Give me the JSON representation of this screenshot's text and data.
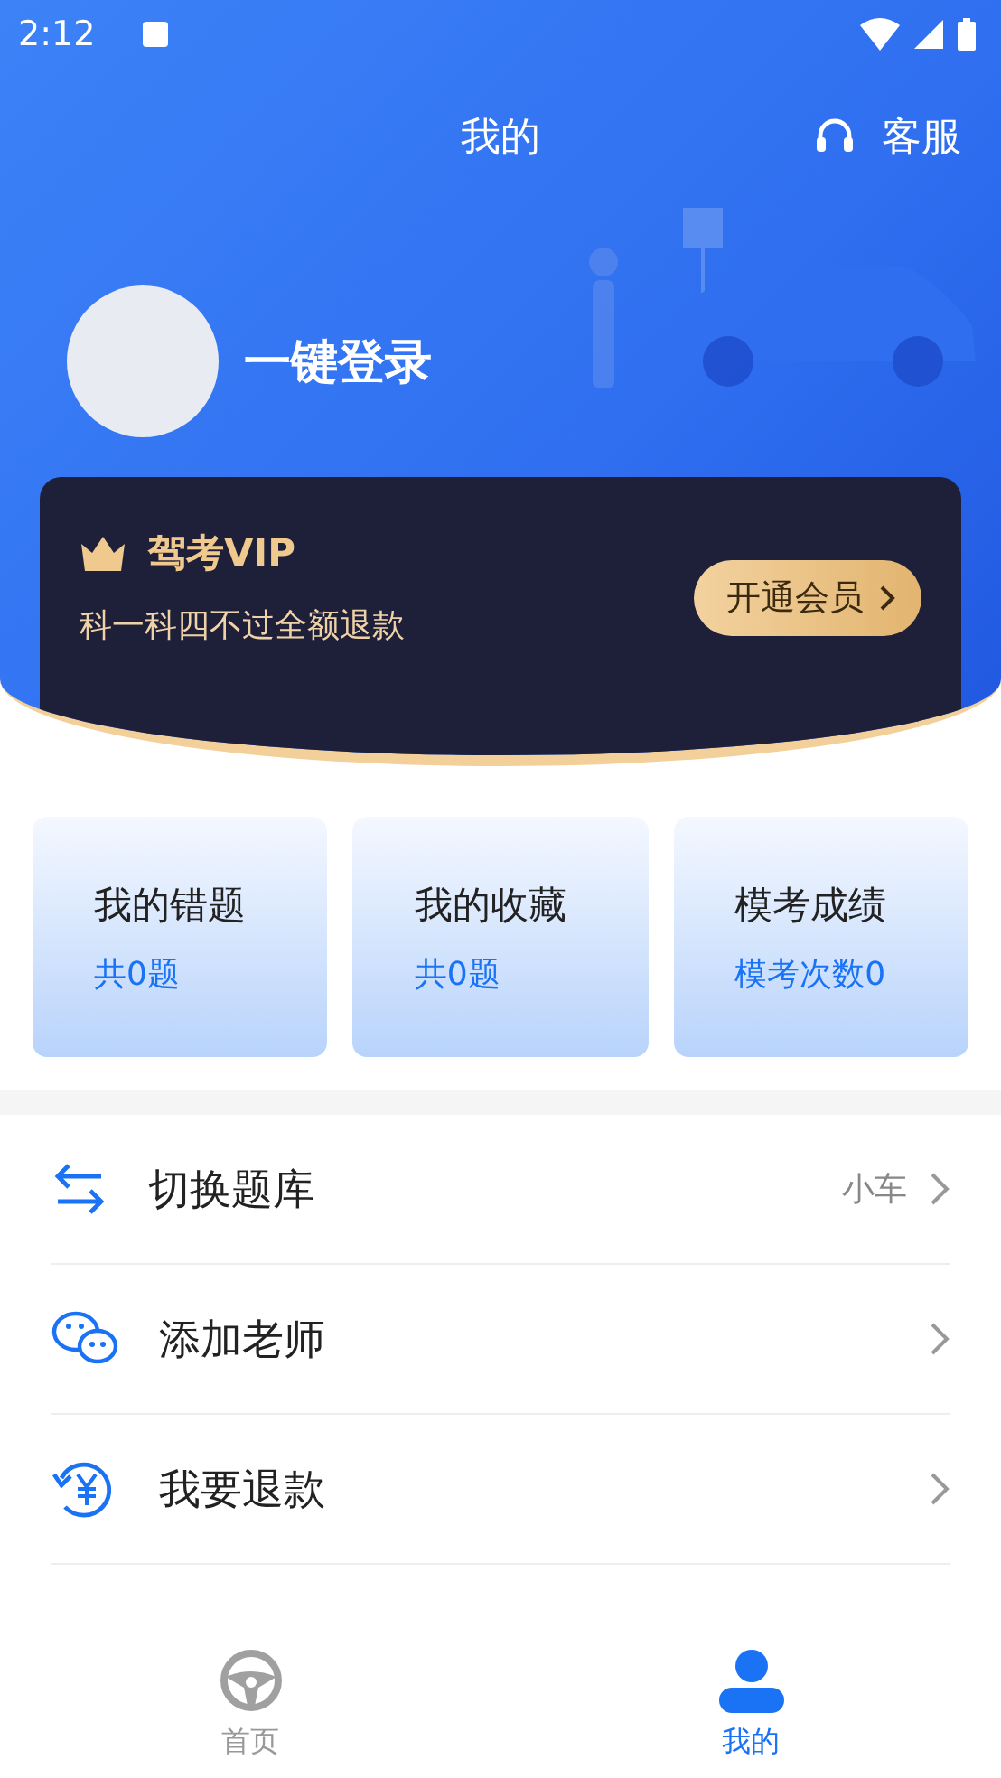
{
  "status_bar": {
    "time": "2:12"
  },
  "header": {
    "title": "我的",
    "service": "客服",
    "login": "一键登录"
  },
  "vip": {
    "title": "驾考VIP",
    "subtitle": "科一科四不过全额退款",
    "button": "开通会员"
  },
  "stats": [
    {
      "title": "我的错题",
      "value": "共0题"
    },
    {
      "title": "我的收藏",
      "value": "共0题"
    },
    {
      "title": "模考成绩",
      "value": "模考次数0"
    }
  ],
  "menu": [
    {
      "kind": "switch",
      "label": "切换题库",
      "value": "小车"
    },
    {
      "kind": "wechat",
      "label": "添加老师"
    },
    {
      "kind": "refund",
      "label": "我要退款"
    }
  ],
  "tabs": [
    {
      "kind": "wheel",
      "label": "首页",
      "selected": false
    },
    {
      "kind": "person",
      "label": "我的",
      "selected": true
    }
  ]
}
